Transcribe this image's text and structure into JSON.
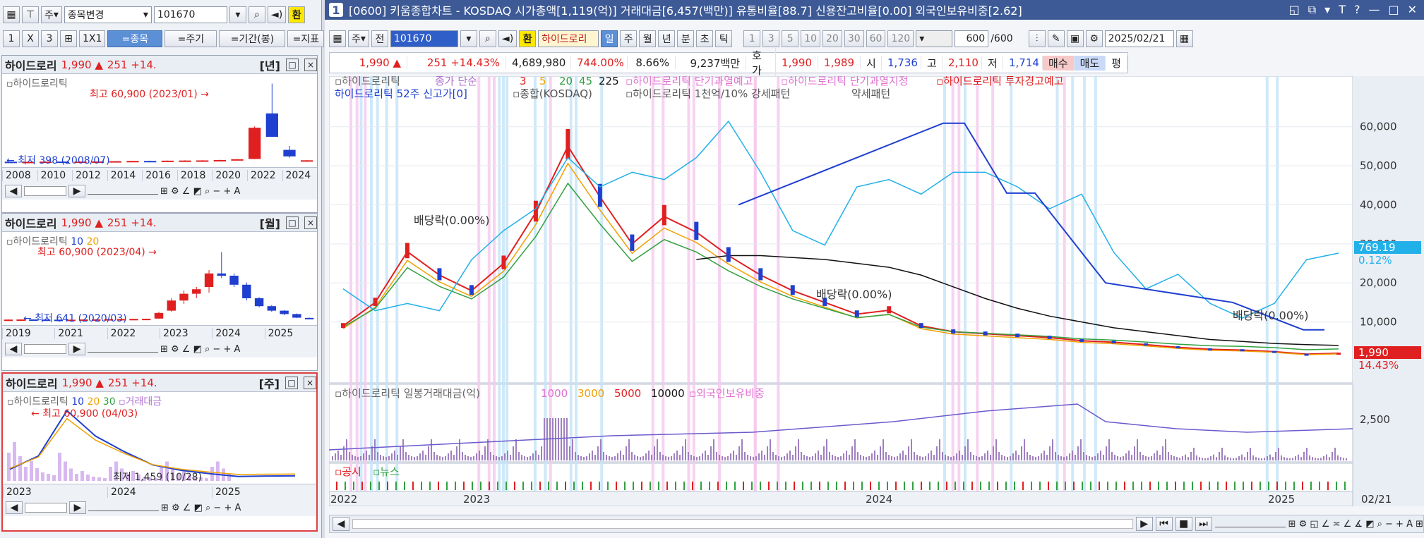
{
  "left": {
    "toolbar1": {
      "market_label": "주",
      "change_stock_label": "종목변경",
      "code": "101670",
      "hwan": "환"
    },
    "toolbar2": {
      "layout_labels": [
        "1",
        "X",
        "3"
      ],
      "mode_labels": [
        "1X1",
        "=종목",
        "=주기",
        "=기간(봉)",
        "=지표"
      ]
    },
    "panels": [
      {
        "name": "하이드로리",
        "price": "1,990 ▲",
        "change": "251 +14.",
        "period": "[년]",
        "legend": "하이드로리틱",
        "high_note": "최고 60,900 (2023/01) →",
        "low_note": "← 최저 398 (2008/07)",
        "x_labels": [
          "2008",
          "2010",
          "2012",
          "2014",
          "2016",
          "2018",
          "2020",
          "2022",
          "2024"
        ],
        "chart_data": {
          "type": "candlestick",
          "title": "",
          "xlabel": "",
          "ylabel": "",
          "categories": [
            "2008",
            "2009",
            "2010",
            "2011",
            "2012",
            "2013",
            "2014",
            "2015",
            "2016",
            "2017",
            "2018",
            "2019",
            "2020",
            "2021",
            "2022",
            "2023",
            "2024",
            "2025"
          ],
          "ohlc": [
            [
              900,
              1000,
              398,
              600
            ],
            [
              600,
              900,
              500,
              800
            ],
            [
              800,
              1200,
              700,
              1000
            ],
            [
              1000,
              1300,
              800,
              900
            ],
            [
              900,
              1100,
              800,
              1000
            ],
            [
              1000,
              1200,
              900,
              1100
            ],
            [
              1100,
              1400,
              1000,
              1300
            ],
            [
              1300,
              1600,
              1200,
              1500
            ],
            [
              1500,
              1700,
              1300,
              1400
            ],
            [
              1400,
              1800,
              1300,
              1700
            ],
            [
              1700,
              2000,
              1500,
              1800
            ],
            [
              1800,
              2100,
              1600,
              1900
            ],
            [
              1900,
              2400,
              1700,
              2200
            ],
            [
              2200,
              3000,
              2000,
              2800
            ],
            [
              3000,
              28000,
              2800,
              27000
            ],
            [
              38000,
              60900,
              20000,
              20000
            ],
            [
              10000,
              13000,
              4000,
              5000
            ],
            [
              1800,
              2100,
              1700,
              1990
            ]
          ],
          "ylim": [
            0,
            65000
          ]
        }
      },
      {
        "name": "하이드로리",
        "price": "1,990 ▲",
        "change": "251 +14.",
        "period": "[월]",
        "legend": "하이드로리틱",
        "ma": [
          "10",
          "20"
        ],
        "high_note": "최고 60,900 (2023/04) →",
        "low_note": "← 최저 641 (2020/03)",
        "x_labels": [
          "2019",
          "2021",
          "2022",
          "2023",
          "2024",
          "2025"
        ],
        "chart_data": {
          "type": "candlestick",
          "title": "",
          "xlabel": "",
          "ylabel": "",
          "categories": [
            "2019-01",
            "2019-04",
            "2019-07",
            "2019-10",
            "2020-01",
            "2020-04",
            "2020-07",
            "2020-10",
            "2021-01",
            "2021-04",
            "2021-07",
            "2021-10",
            "2022-01",
            "2022-04",
            "2022-07",
            "2022-10",
            "2023-01",
            "2023-04",
            "2023-07",
            "2023-10",
            "2024-01",
            "2024-04",
            "2024-07",
            "2024-10",
            "2025-01"
          ],
          "ohlc": [
            [
              1000,
              1200,
              900,
              1100
            ],
            [
              1100,
              1300,
              1000,
              1200
            ],
            [
              1200,
              1300,
              1000,
              1100
            ],
            [
              1100,
              1200,
              900,
              1000
            ],
            [
              1000,
              1100,
              700,
              900
            ],
            [
              900,
              1100,
              641,
              1000
            ],
            [
              1000,
              1300,
              900,
              1200
            ],
            [
              1200,
              1400,
              1100,
              1300
            ],
            [
              1300,
              1600,
              1200,
              1500
            ],
            [
              1500,
              1700,
              1400,
              1600
            ],
            [
              1600,
              1800,
              1500,
              1700
            ],
            [
              1700,
              1900,
              1600,
              1800
            ],
            [
              2000,
              8000,
              1800,
              7000
            ],
            [
              9000,
              20000,
              8000,
              18000
            ],
            [
              18000,
              27000,
              15000,
              24000
            ],
            [
              24000,
              30000,
              20000,
              28000
            ],
            [
              30000,
              45000,
              25000,
              42000
            ],
            [
              42000,
              60900,
              38000,
              40000
            ],
            [
              40000,
              42000,
              30000,
              32000
            ],
            [
              32000,
              34000,
              18000,
              20000
            ],
            [
              20000,
              21000,
              12000,
              13000
            ],
            [
              13000,
              14000,
              8000,
              9000
            ],
            [
              9000,
              9500,
              5000,
              6000
            ],
            [
              6000,
              6500,
              2500,
              2800
            ],
            [
              2600,
              2900,
              1700,
              1990
            ]
          ],
          "ylim": [
            0,
            70000
          ]
        }
      },
      {
        "name": "하이드로리",
        "price": "1,990 ▲",
        "change": "251 +14.",
        "period": "[주]",
        "legend": "하이드로리틱",
        "ma": [
          "10",
          "20",
          "30"
        ],
        "legend_extra": "거래대금",
        "high_note": "← 최고 60,900 (04/03)",
        "low_note": "최저 1,459 (10/28)",
        "x_labels": [
          "2023",
          "2024",
          "2025"
        ],
        "chart_data": {
          "type": "line",
          "title": "",
          "xlabel": "",
          "ylabel": "",
          "x": [
            "2022-10",
            "2023-01",
            "2023-04",
            "2023-07",
            "2023-10",
            "2024-01",
            "2024-04",
            "2024-07",
            "2024-10",
            "2025-01",
            "2025-02"
          ],
          "series": [
            {
              "values": [
                8000,
                20000,
                60900,
                38000,
                24000,
                12000,
                7000,
                4000,
                1459,
                1800,
                1990
              ]
            }
          ],
          "ylim": [
            0,
            65000
          ]
        }
      }
    ]
  },
  "main": {
    "titlebar": {
      "num": "1",
      "title": "[0600] 키움종합차트 - KOSDAQ 시가총액[1,119(억)] 거래대금[6,457(백만)] 유통비율[88.7] 신용잔고비율[0.00] 외국인보유비중[2.62]"
    },
    "toolbar": {
      "market": "주",
      "prev": "전",
      "code": "101670",
      "hwan": "환",
      "name": "하이드로리",
      "periods": [
        "일",
        "주",
        "월",
        "년",
        "분",
        "초",
        "틱"
      ],
      "ticks": [
        "1",
        "3",
        "5",
        "10",
        "20",
        "30",
        "60",
        "120"
      ],
      "count": "600",
      "count_total": "/600",
      "date": "2025/02/21"
    },
    "quote": {
      "price": "1,990 ▲",
      "change": "251 +14.43%",
      "volume": "4,689,980",
      "vol_ratio": "744.00%",
      "turnover": "8.66%",
      "amount": "9,237백만",
      "hoga_label": "호가",
      "ask": "1,990",
      "bid": "1,989",
      "open_label": "시",
      "open": "1,736",
      "high_label": "고",
      "high": "2,110",
      "low_label": "저",
      "low": "1,714",
      "buy": "매수",
      "sell": "매도",
      "eval": "평"
    },
    "price_legend": {
      "name": "하이드로리틱",
      "ma_label": "종가 단순",
      "ma": [
        "3",
        "5",
        "20",
        "45",
        "225"
      ],
      "warn1": "하이드로리틱 단기과열예고",
      "warn2": "하이드로리틱 단기과열지정",
      "warn3": "하이드로리틱 투자경고예고",
      "line2a": "하이드로리틱 52주 신고가[0]",
      "line2b": "종합(KOSDAQ)",
      "line2c": "하이드로리틱 1천억/10% 강세패턴",
      "line2d": "약세패턴"
    },
    "dividend_label": "배당락(0.00%)",
    "right_axis": {
      "ticks": [
        "60,000",
        "50,000",
        "40,000",
        "30,000",
        "20,000",
        "10,000"
      ],
      "kosdaq_tag": "769.19",
      "kosdaq_pct": "0.12%",
      "price_tag": "1,990",
      "price_pct": "14.43%"
    },
    "vol_legend": {
      "name": "하이드로리틱 일봉거래대금(억)",
      "ma": [
        "1000",
        "3000",
        "5000",
        "10000"
      ],
      "foreign": "외국인보유비중"
    },
    "vol_axis": "2,500",
    "news_legend": {
      "a": "공시",
      "b": "뉴스"
    },
    "x_labels": [
      "2022",
      "2023",
      "2024",
      "2025"
    ],
    "date_right": "02/21",
    "chart_data": {
      "type": "candlestick",
      "title": "",
      "xlabel": "",
      "ylabel": "",
      "x": [
        "2022-10-24",
        "2022-11-15",
        "2022-12-05",
        "2023-01-05",
        "2023-02-01",
        "2023-02-20",
        "2023-03-10",
        "2023-04-03",
        "2023-04-20",
        "2023-05-15",
        "2023-06-10",
        "2023-07-05",
        "2023-08-01",
        "2023-09-01",
        "2023-10-01",
        "2023-11-01",
        "2023-12-01",
        "2024-01-02",
        "2024-02-01",
        "2024-03-01",
        "2024-04-01",
        "2024-05-01",
        "2024-06-01",
        "2024-07-01",
        "2024-08-01",
        "2024-09-01",
        "2024-10-01",
        "2024-11-01",
        "2024-12-01",
        "2025-01-02",
        "2025-02-01",
        "2025-02-21"
      ],
      "series": [
        {
          "name": "하이드로리틱",
          "values": [
            9000,
            15000,
            28000,
            22000,
            18000,
            25000,
            38000,
            55000,
            42000,
            30000,
            37000,
            33000,
            27000,
            22000,
            18000,
            15000,
            12000,
            13000,
            9000,
            7500,
            7000,
            6500,
            6000,
            5200,
            4800,
            4200,
            3500,
            3000,
            2800,
            2400,
            1750,
            1990
          ]
        },
        {
          "name": "종합(KOSDAQ)",
          "values": [
            720,
            690,
            700,
            690,
            760,
            800,
            830,
            900,
            860,
            880,
            870,
            900,
            950,
            880,
            800,
            780,
            860,
            870,
            850,
            880,
            880,
            860,
            830,
            850,
            770,
            720,
            740,
            700,
            680,
            700,
            760,
            769
          ]
        }
      ],
      "ylim": [
        0,
        65000
      ]
    }
  },
  "colors": {
    "title_bg": "#3d5a96",
    "up": "#e02020",
    "down": "#1f3fd0",
    "kosdaq": "#22b0e8",
    "ma3": "#e02020",
    "ma5": "#f0a000",
    "ma20": "#32a040",
    "ma45": "#32a040",
    "ma225": "#111111",
    "pink_band": "#f5c8ee",
    "blue_band": "#c4e4f8",
    "newhigh": "#1f3fd0",
    "foreign": "#6a5acd",
    "vol": "#a080c0"
  }
}
